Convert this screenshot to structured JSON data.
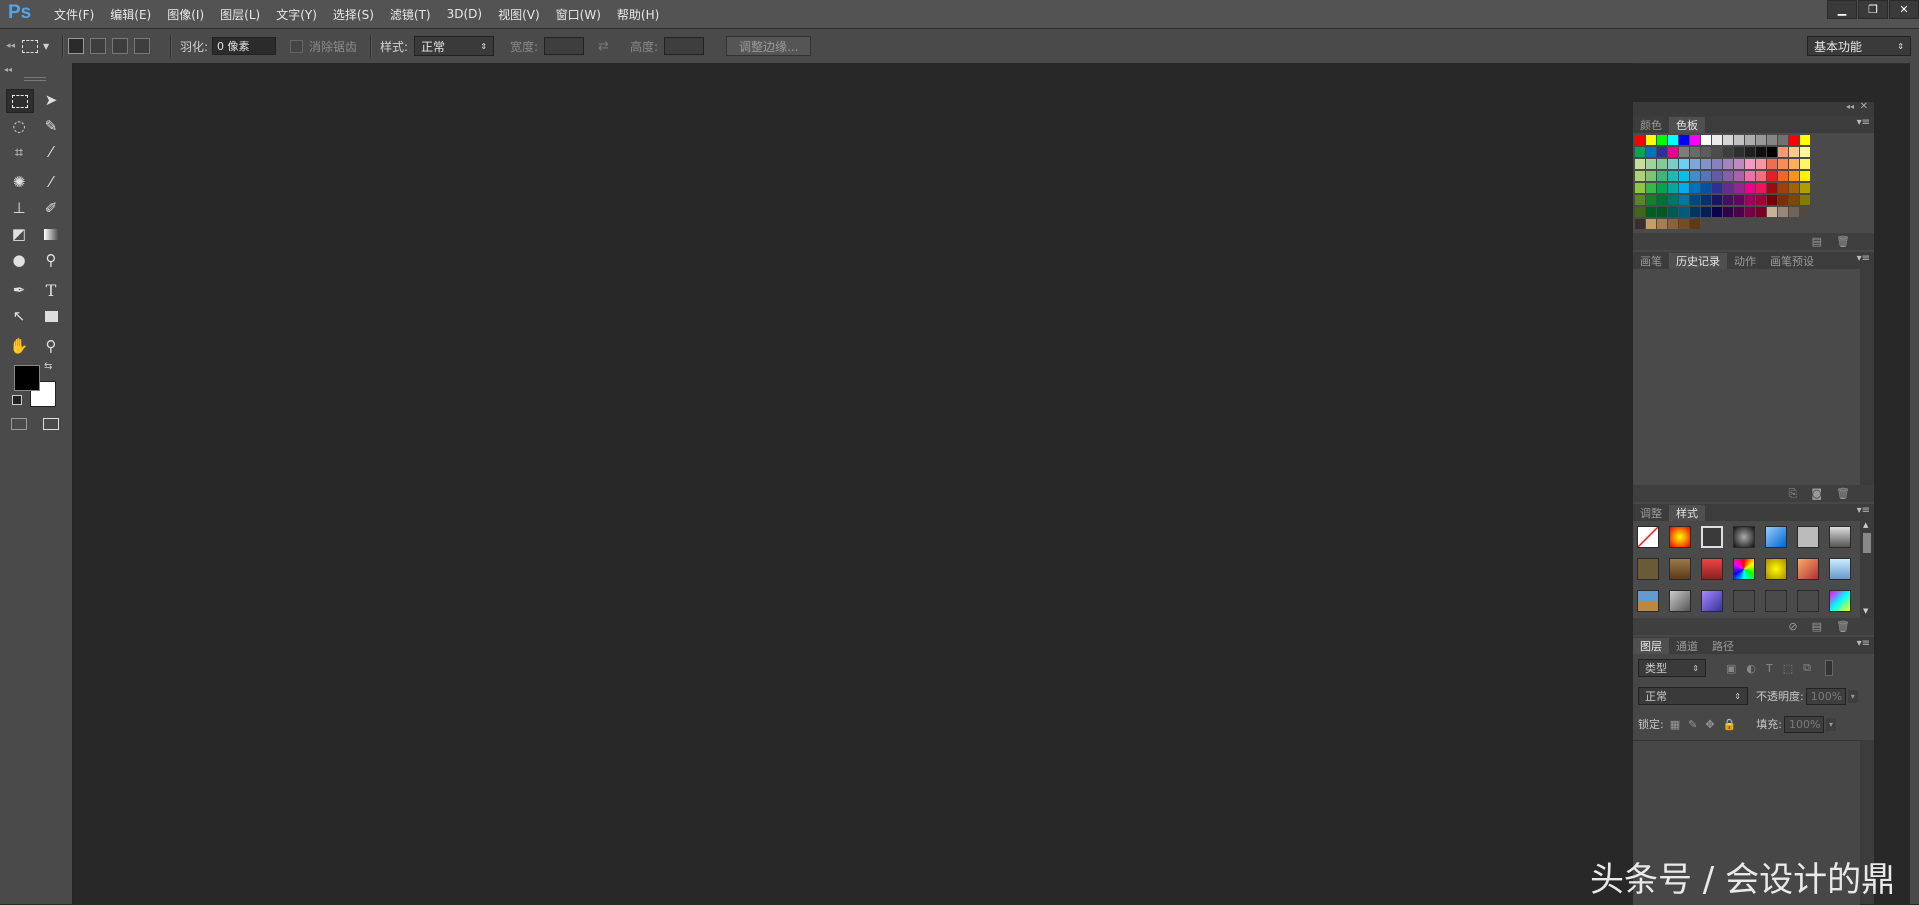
{
  "app": {
    "logo": "Ps"
  },
  "menubar": {
    "items": [
      "文件(F)",
      "编辑(E)",
      "图像(I)",
      "图层(L)",
      "文字(Y)",
      "选择(S)",
      "滤镜(T)",
      "3D(D)",
      "视图(V)",
      "窗口(W)",
      "帮助(H)"
    ],
    "window_controls": [
      "▁",
      "❐",
      "✕"
    ]
  },
  "options": {
    "feather_label": "羽化:",
    "feather_value": "0 像素",
    "antialias_label": "消除锯齿",
    "style_label": "样式:",
    "style_value": "正常",
    "width_label": "宽度:",
    "height_label": "高度:",
    "refine_edge": "调整边缘...",
    "workspace": "基本功能"
  },
  "tools": {
    "colors": {
      "foreground": "#000000",
      "background": "#ffffff"
    }
  },
  "panels": {
    "swatches": {
      "tabs": [
        "颜色",
        "色板"
      ],
      "active": 1
    },
    "history": {
      "tabs": [
        "画笔",
        "历史记录",
        "动作",
        "画笔预设"
      ],
      "active": 1
    },
    "styles": {
      "tabs": [
        "调整",
        "样式"
      ],
      "active": 1
    },
    "layers": {
      "tabs": [
        "图层",
        "通道",
        "路径"
      ],
      "active": 0,
      "filter_kind": "类型",
      "blend_mode": "正常",
      "opacity_label": "不透明度:",
      "opacity_value": "100%",
      "lock_label": "锁定:",
      "fill_label": "填充:",
      "fill_value": "100%"
    }
  },
  "watermark": "头条号 / 会设计的鼎",
  "swatch_colors": [
    [
      "#ff0000",
      "#ffff00",
      "#00ff00",
      "#00ffff",
      "#0000ff",
      "#ff00ff",
      "#ffffff",
      "#ebebeb",
      "#d6d6d6",
      "#c2c2c2",
      "#adadad",
      "#999999",
      "#858585",
      "#707070",
      "#ff0000",
      "#ffff00"
    ],
    [
      "#00a651",
      "#0072bc",
      "#2e3192",
      "#ec008c",
      "#7d7d7d",
      "#6b6b6b",
      "#5c5c5c",
      "#4d4d4d",
      "#3d3d3d",
      "#2e2e2e",
      "#1f1f1f",
      "#0f0f0f",
      "#000000",
      "#f7977a",
      "#fdc68a",
      "#fff79a"
    ],
    [
      "#c4df9b",
      "#a3d39c",
      "#82ca9c",
      "#7accc8",
      "#6dcff6",
      "#7da7d9",
      "#8393ca",
      "#8781bd",
      "#a186be",
      "#bd8cbf",
      "#f49ac1",
      "#f5989d",
      "#f26c4f",
      "#f68e56",
      "#fbaf5d",
      "#fff568"
    ],
    [
      "#acd373",
      "#7cc576",
      "#3bb878",
      "#1abbb4",
      "#00bff3",
      "#438ccb",
      "#5574b9",
      "#605ca8",
      "#855fa8",
      "#a763a8",
      "#f06eaa",
      "#f26d7d",
      "#ed1c24",
      "#f26522",
      "#f7941d",
      "#fff200"
    ],
    [
      "#8dc63f",
      "#39b54a",
      "#00a651",
      "#00a99d",
      "#00aeef",
      "#0072bc",
      "#0054a6",
      "#2e3192",
      "#662d91",
      "#92278f",
      "#ec008c",
      "#ed145b",
      "#9e0b0f",
      "#a0410d",
      "#a36209",
      "#aba000"
    ],
    [
      "#598527",
      "#197b30",
      "#007236",
      "#00746b",
      "#0076a3",
      "#004a80",
      "#003471",
      "#1b1464",
      "#440e62",
      "#630460",
      "#9e005d",
      "#9e0039",
      "#790000",
      "#7b2e00",
      "#7d4900",
      "#827b00"
    ],
    [
      "#406618",
      "#005e20",
      "#005826",
      "#005952",
      "#005b7f",
      "#003663",
      "#002157",
      "#0d004c",
      "#32004b",
      "#4b0049",
      "#7b0046",
      "#7a0026",
      "#c7b299",
      "#998675",
      "#736357",
      "#534741"
    ],
    [
      "#37302a",
      "#c69c6d",
      "#a67c52",
      "#8c6239",
      "#754c24",
      "#603913"
    ]
  ]
}
